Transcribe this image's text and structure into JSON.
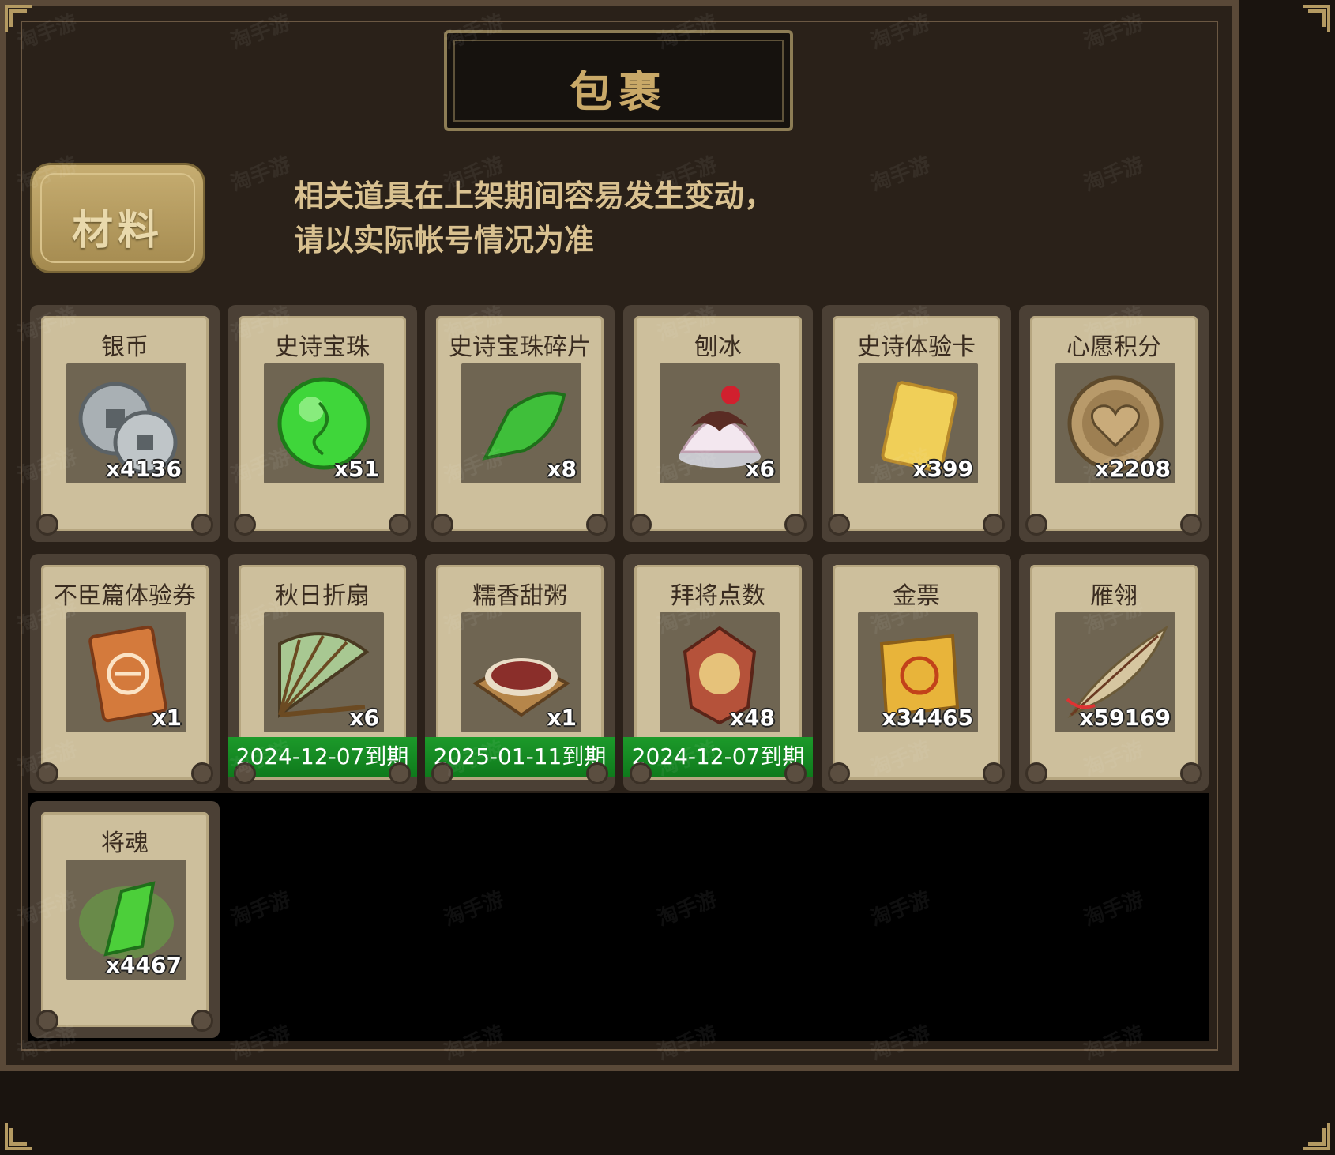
{
  "header": {
    "title": "包裹"
  },
  "tabs": {
    "active": "材料"
  },
  "notice": {
    "line1": "相关道具在上架期间容易发生变动，",
    "line2": "请以实际帐号情况为准"
  },
  "items": [
    {
      "name": "银币",
      "qty": "x4136",
      "icon": "silver-coin-icon"
    },
    {
      "name": "史诗宝珠",
      "qty": "x51",
      "icon": "green-orb-icon"
    },
    {
      "name": "史诗宝珠碎片",
      "qty": "x8",
      "icon": "jade-shard-icon"
    },
    {
      "name": "刨冰",
      "qty": "x6",
      "icon": "shaved-ice-icon"
    },
    {
      "name": "史诗体验卡",
      "qty": "x399",
      "icon": "gold-card-icon"
    },
    {
      "name": "心愿积分",
      "qty": "x2208",
      "icon": "heart-coin-icon"
    },
    {
      "name": "不臣篇体验券",
      "qty": "x1",
      "icon": "ticket-icon"
    },
    {
      "name": "秋日折扇",
      "qty": "x6",
      "icon": "folding-fan-icon",
      "expiry": "2024-12-07到期"
    },
    {
      "name": "糯香甜粥",
      "qty": "x1",
      "icon": "porridge-icon",
      "expiry": "2025-01-11到期"
    },
    {
      "name": "拜将点数",
      "qty": "x48",
      "icon": "general-token-icon",
      "expiry": "2024-12-07到期"
    },
    {
      "name": "金票",
      "qty": "x34465",
      "icon": "gold-scroll-icon"
    },
    {
      "name": "雁翎",
      "qty": "x59169",
      "icon": "feather-icon"
    },
    {
      "name": "将魂",
      "qty": "x4467",
      "icon": "green-crystal-icon"
    }
  ],
  "watermark": "淘手游"
}
